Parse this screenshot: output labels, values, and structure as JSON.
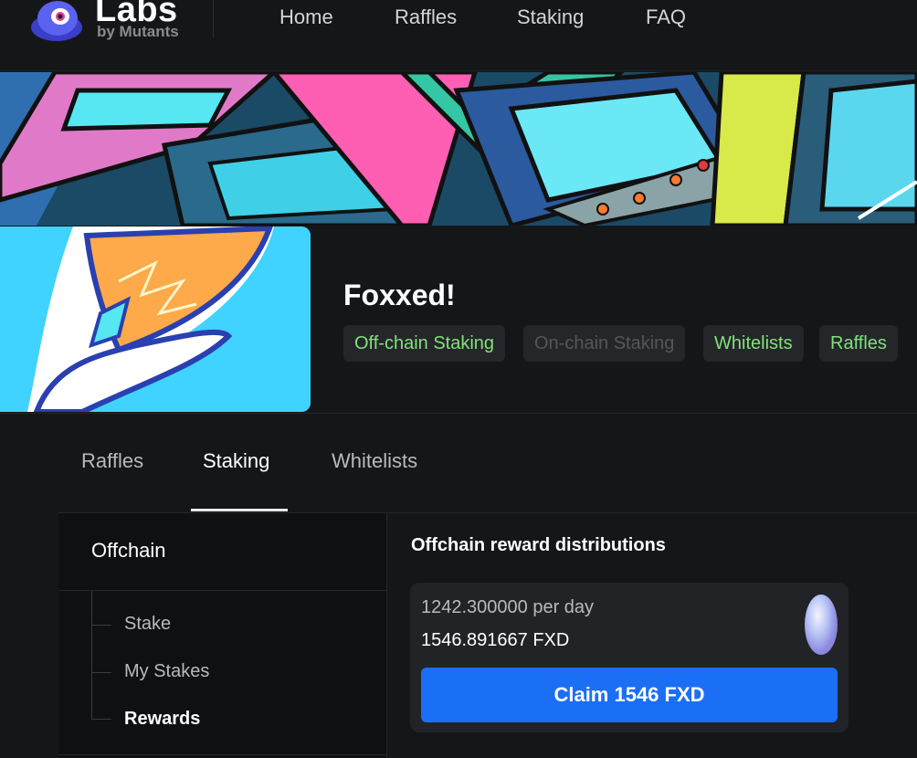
{
  "brand": {
    "name": "Labs",
    "sub": "by Mutants",
    "logo_icon": "mutant-blob-icon"
  },
  "nav": {
    "items": [
      "Home",
      "Raffles",
      "Staking",
      "FAQ"
    ]
  },
  "banner": {
    "icon": "arcade-machines-artwork"
  },
  "project": {
    "title": "Foxxed!",
    "avatar_icon": "fox-tail-logo",
    "tags": [
      {
        "label": "Off-chain Staking",
        "enabled": true
      },
      {
        "label": "On-chain Staking",
        "enabled": false
      },
      {
        "label": "Whitelists",
        "enabled": true
      },
      {
        "label": "Raffles",
        "enabled": true
      }
    ]
  },
  "tabs": {
    "items": [
      "Raffles",
      "Staking",
      "Whitelists"
    ],
    "active": "Staking"
  },
  "sidebar": {
    "heading": "Offchain",
    "items": [
      "Stake",
      "My Stakes",
      "Rewards"
    ],
    "active": "Rewards"
  },
  "rewards": {
    "title": "Offchain reward distributions",
    "per_day": "1242.300000 per day",
    "amount": "1546.891667 FXD",
    "token_icon": "fxd-token-icon",
    "claim_label": "Claim 1546 FXD"
  },
  "colors": {
    "accent": "#1a6ff5",
    "enabled_tag": "#7fe37a",
    "disabled_tag": "#55565a",
    "background": "#151618"
  }
}
